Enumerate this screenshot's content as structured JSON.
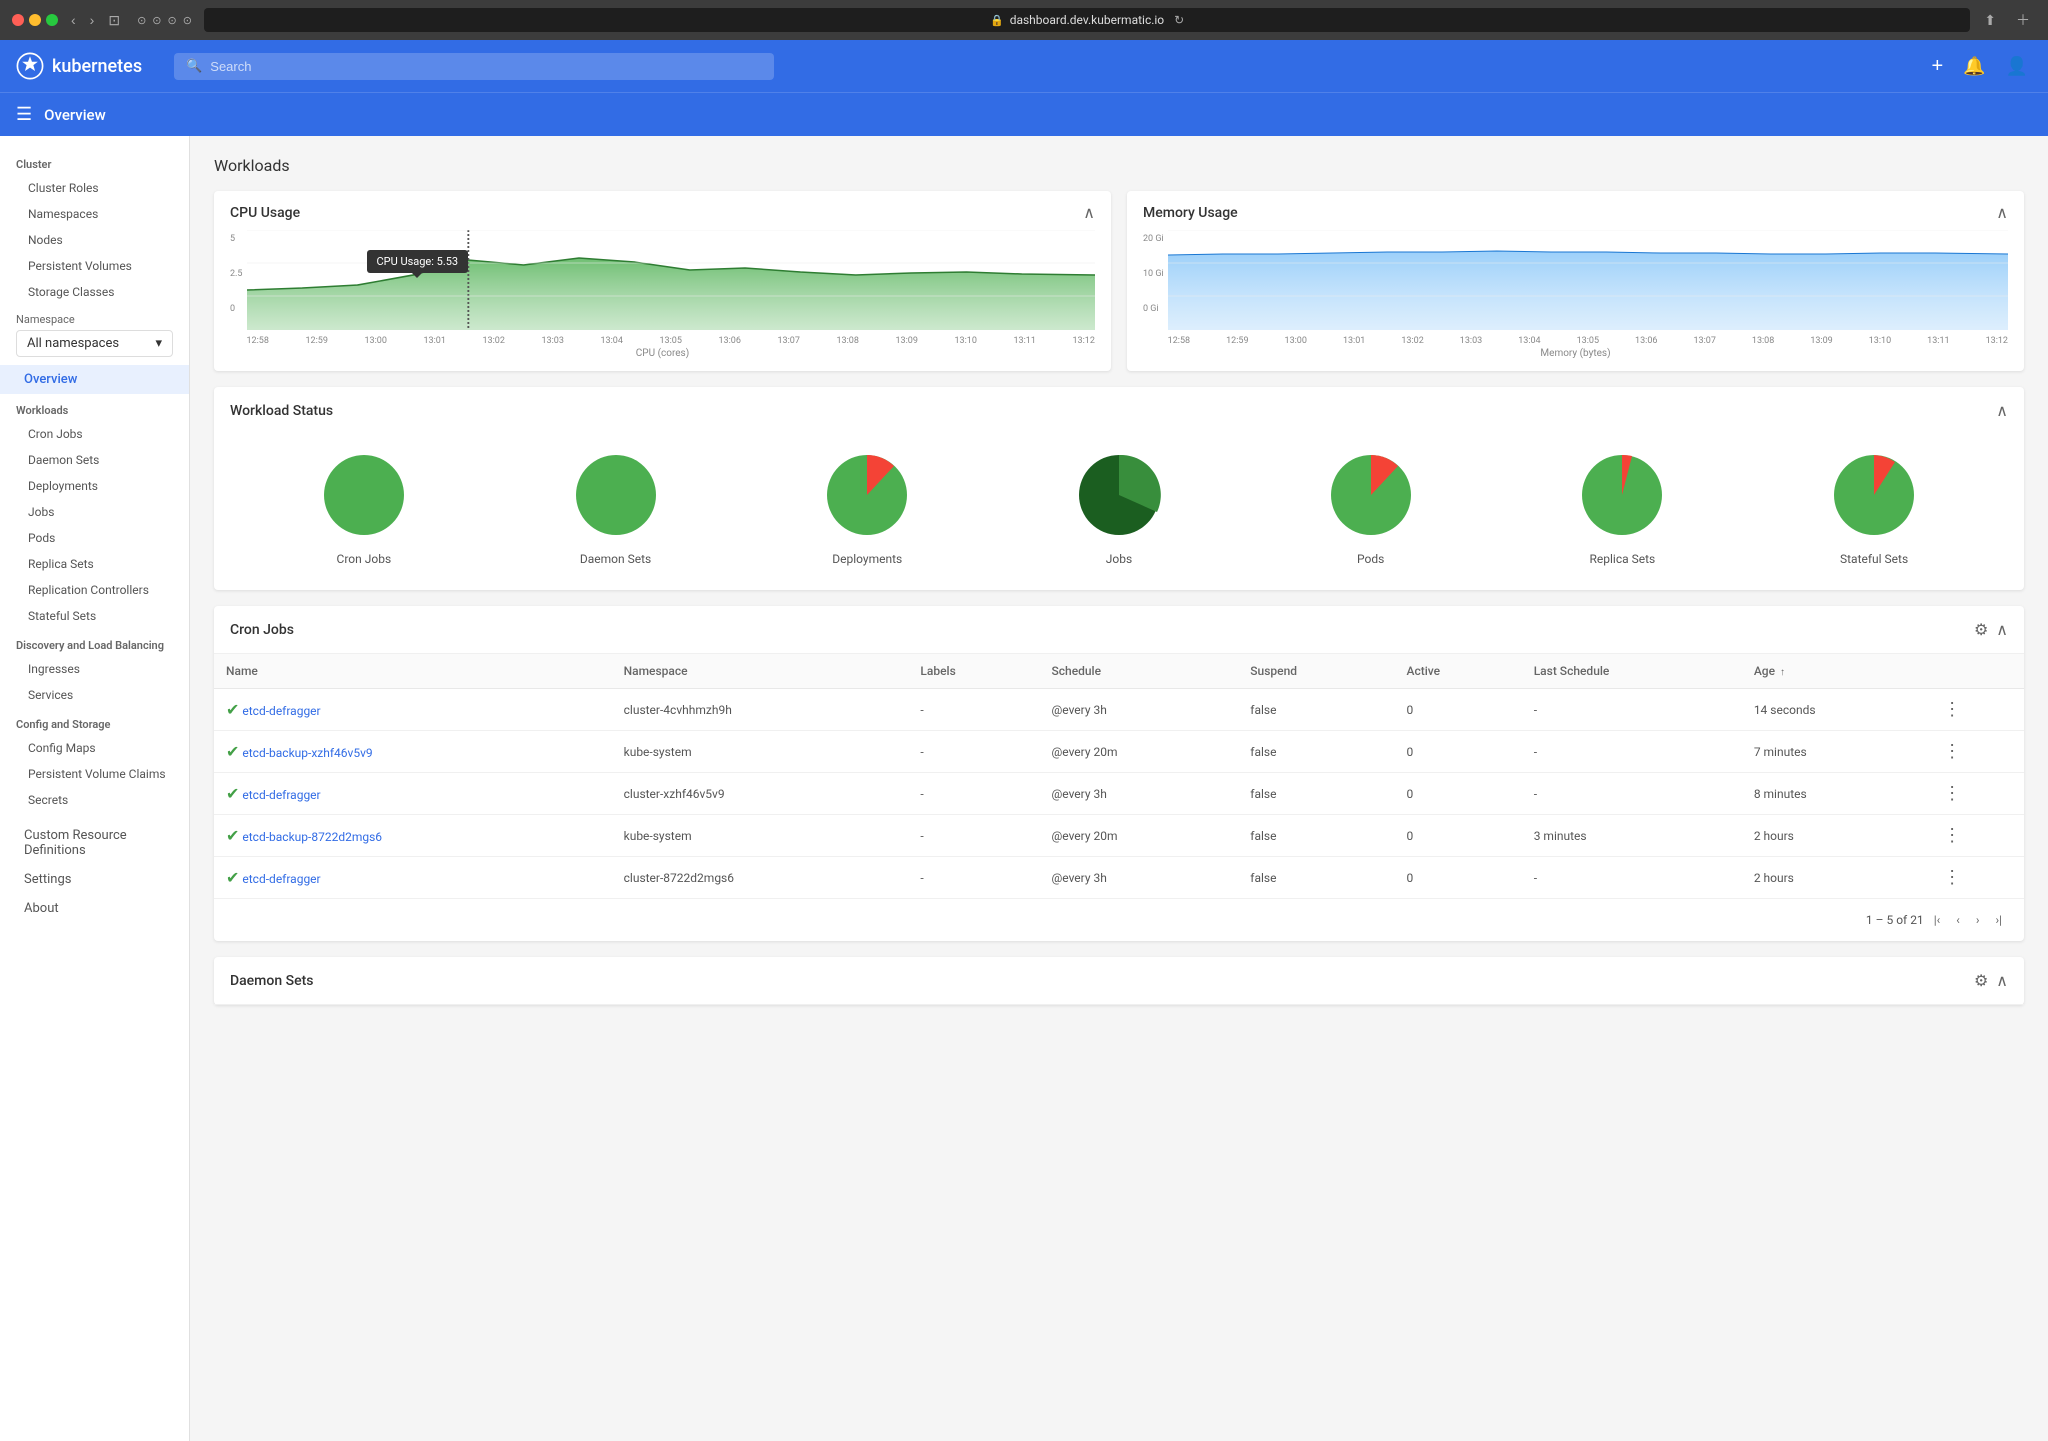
{
  "browser": {
    "url": "dashboard.dev.kubermatic.io",
    "lock_icon": "🔒"
  },
  "header": {
    "logo_text": "kubernetes",
    "search_placeholder": "Search",
    "add_btn": "+",
    "notif_btn": "🔔",
    "user_btn": "👤"
  },
  "subheader": {
    "title": "Overview"
  },
  "sidebar": {
    "cluster_section": "Cluster",
    "cluster_items": [
      {
        "label": "Cluster Roles",
        "id": "cluster-roles"
      },
      {
        "label": "Namespaces",
        "id": "namespaces"
      },
      {
        "label": "Nodes",
        "id": "nodes"
      },
      {
        "label": "Persistent Volumes",
        "id": "persistent-volumes"
      },
      {
        "label": "Storage Classes",
        "id": "storage-classes"
      }
    ],
    "namespace_label": "Namespace",
    "namespace_value": "All namespaces",
    "overview_label": "Overview",
    "workloads_section": "Workloads",
    "workload_items": [
      {
        "label": "Cron Jobs",
        "id": "cron-jobs"
      },
      {
        "label": "Daemon Sets",
        "id": "daemon-sets"
      },
      {
        "label": "Deployments",
        "id": "deployments"
      },
      {
        "label": "Jobs",
        "id": "jobs"
      },
      {
        "label": "Pods",
        "id": "pods"
      },
      {
        "label": "Replica Sets",
        "id": "replica-sets"
      },
      {
        "label": "Replication Controllers",
        "id": "replication-controllers"
      },
      {
        "label": "Stateful Sets",
        "id": "stateful-sets"
      }
    ],
    "discovery_section": "Discovery and Load Balancing",
    "discovery_items": [
      {
        "label": "Ingresses",
        "id": "ingresses"
      },
      {
        "label": "Services",
        "id": "services"
      }
    ],
    "config_section": "Config and Storage",
    "config_items": [
      {
        "label": "Config Maps",
        "id": "config-maps"
      },
      {
        "label": "Persistent Volume Claims",
        "id": "pvc"
      },
      {
        "label": "Secrets",
        "id": "secrets"
      }
    ],
    "crd_label": "Custom Resource Definitions",
    "settings_label": "Settings",
    "about_label": "About"
  },
  "main": {
    "page_title": "Workloads",
    "cpu_chart": {
      "title": "CPU Usage",
      "y_label": "CPU (cores)",
      "tooltip": "CPU Usage: 5.53",
      "times": [
        "12:58",
        "12:59",
        "13:00",
        "13:01",
        "13:02",
        "13:03",
        "13:04",
        "13:05",
        "13:06",
        "13:07",
        "13:08",
        "13:09",
        "13:10",
        "13:11",
        "13:12"
      ],
      "y_max": "5",
      "y_min": "0"
    },
    "memory_chart": {
      "title": "Memory Usage",
      "y_label": "Memory (bytes)",
      "y_max": "20 Gi",
      "y_min": "0 Gi",
      "times": [
        "12:58",
        "12:59",
        "13:00",
        "13:01",
        "13:02",
        "13:03",
        "13:04",
        "13:05",
        "13:06",
        "13:07",
        "13:08",
        "13:09",
        "13:10",
        "13:11",
        "13:12"
      ]
    },
    "workload_status": {
      "title": "Workload Status",
      "charts": [
        {
          "label": "Cron Jobs",
          "id": "cron-jobs-pie"
        },
        {
          "label": "Daemon Sets",
          "id": "daemon-sets-pie"
        },
        {
          "label": "Deployments",
          "id": "deployments-pie"
        },
        {
          "label": "Jobs",
          "id": "jobs-pie"
        },
        {
          "label": "Pods",
          "id": "pods-pie"
        },
        {
          "label": "Replica Sets",
          "id": "replica-sets-pie"
        },
        {
          "label": "Stateful Sets",
          "id": "stateful-sets-pie"
        }
      ]
    },
    "cron_jobs": {
      "title": "Cron Jobs",
      "columns": [
        "Name",
        "Namespace",
        "Labels",
        "Schedule",
        "Suspend",
        "Active",
        "Last Schedule",
        "Age"
      ],
      "sort_col": "Age",
      "rows": [
        {
          "name": "etcd-defragger",
          "namespace": "cluster-4cvhhmzh9h",
          "labels": "-",
          "schedule": "@every 3h",
          "suspend": "false",
          "active": "0",
          "last_schedule": "-",
          "age": "14 seconds"
        },
        {
          "name": "etcd-backup-xzhf46v5v9",
          "namespace": "kube-system",
          "labels": "-",
          "schedule": "@every 20m",
          "suspend": "false",
          "active": "0",
          "last_schedule": "-",
          "age": "7 minutes"
        },
        {
          "name": "etcd-defragger",
          "namespace": "cluster-xzhf46v5v9",
          "labels": "-",
          "schedule": "@every 3h",
          "suspend": "false",
          "active": "0",
          "last_schedule": "-",
          "age": "8 minutes"
        },
        {
          "name": "etcd-backup-8722d2mgs6",
          "namespace": "kube-system",
          "labels": "-",
          "schedule": "@every 20m",
          "suspend": "false",
          "active": "0",
          "last_schedule": "3 minutes",
          "age": "2 hours"
        },
        {
          "name": "etcd-defragger",
          "namespace": "cluster-8722d2mgs6",
          "labels": "-",
          "schedule": "@every 3h",
          "suspend": "false",
          "active": "0",
          "last_schedule": "-",
          "age": "2 hours"
        }
      ],
      "pagination": "1 – 5 of 21"
    },
    "daemon_sets": {
      "title": "Daemon Sets"
    }
  }
}
